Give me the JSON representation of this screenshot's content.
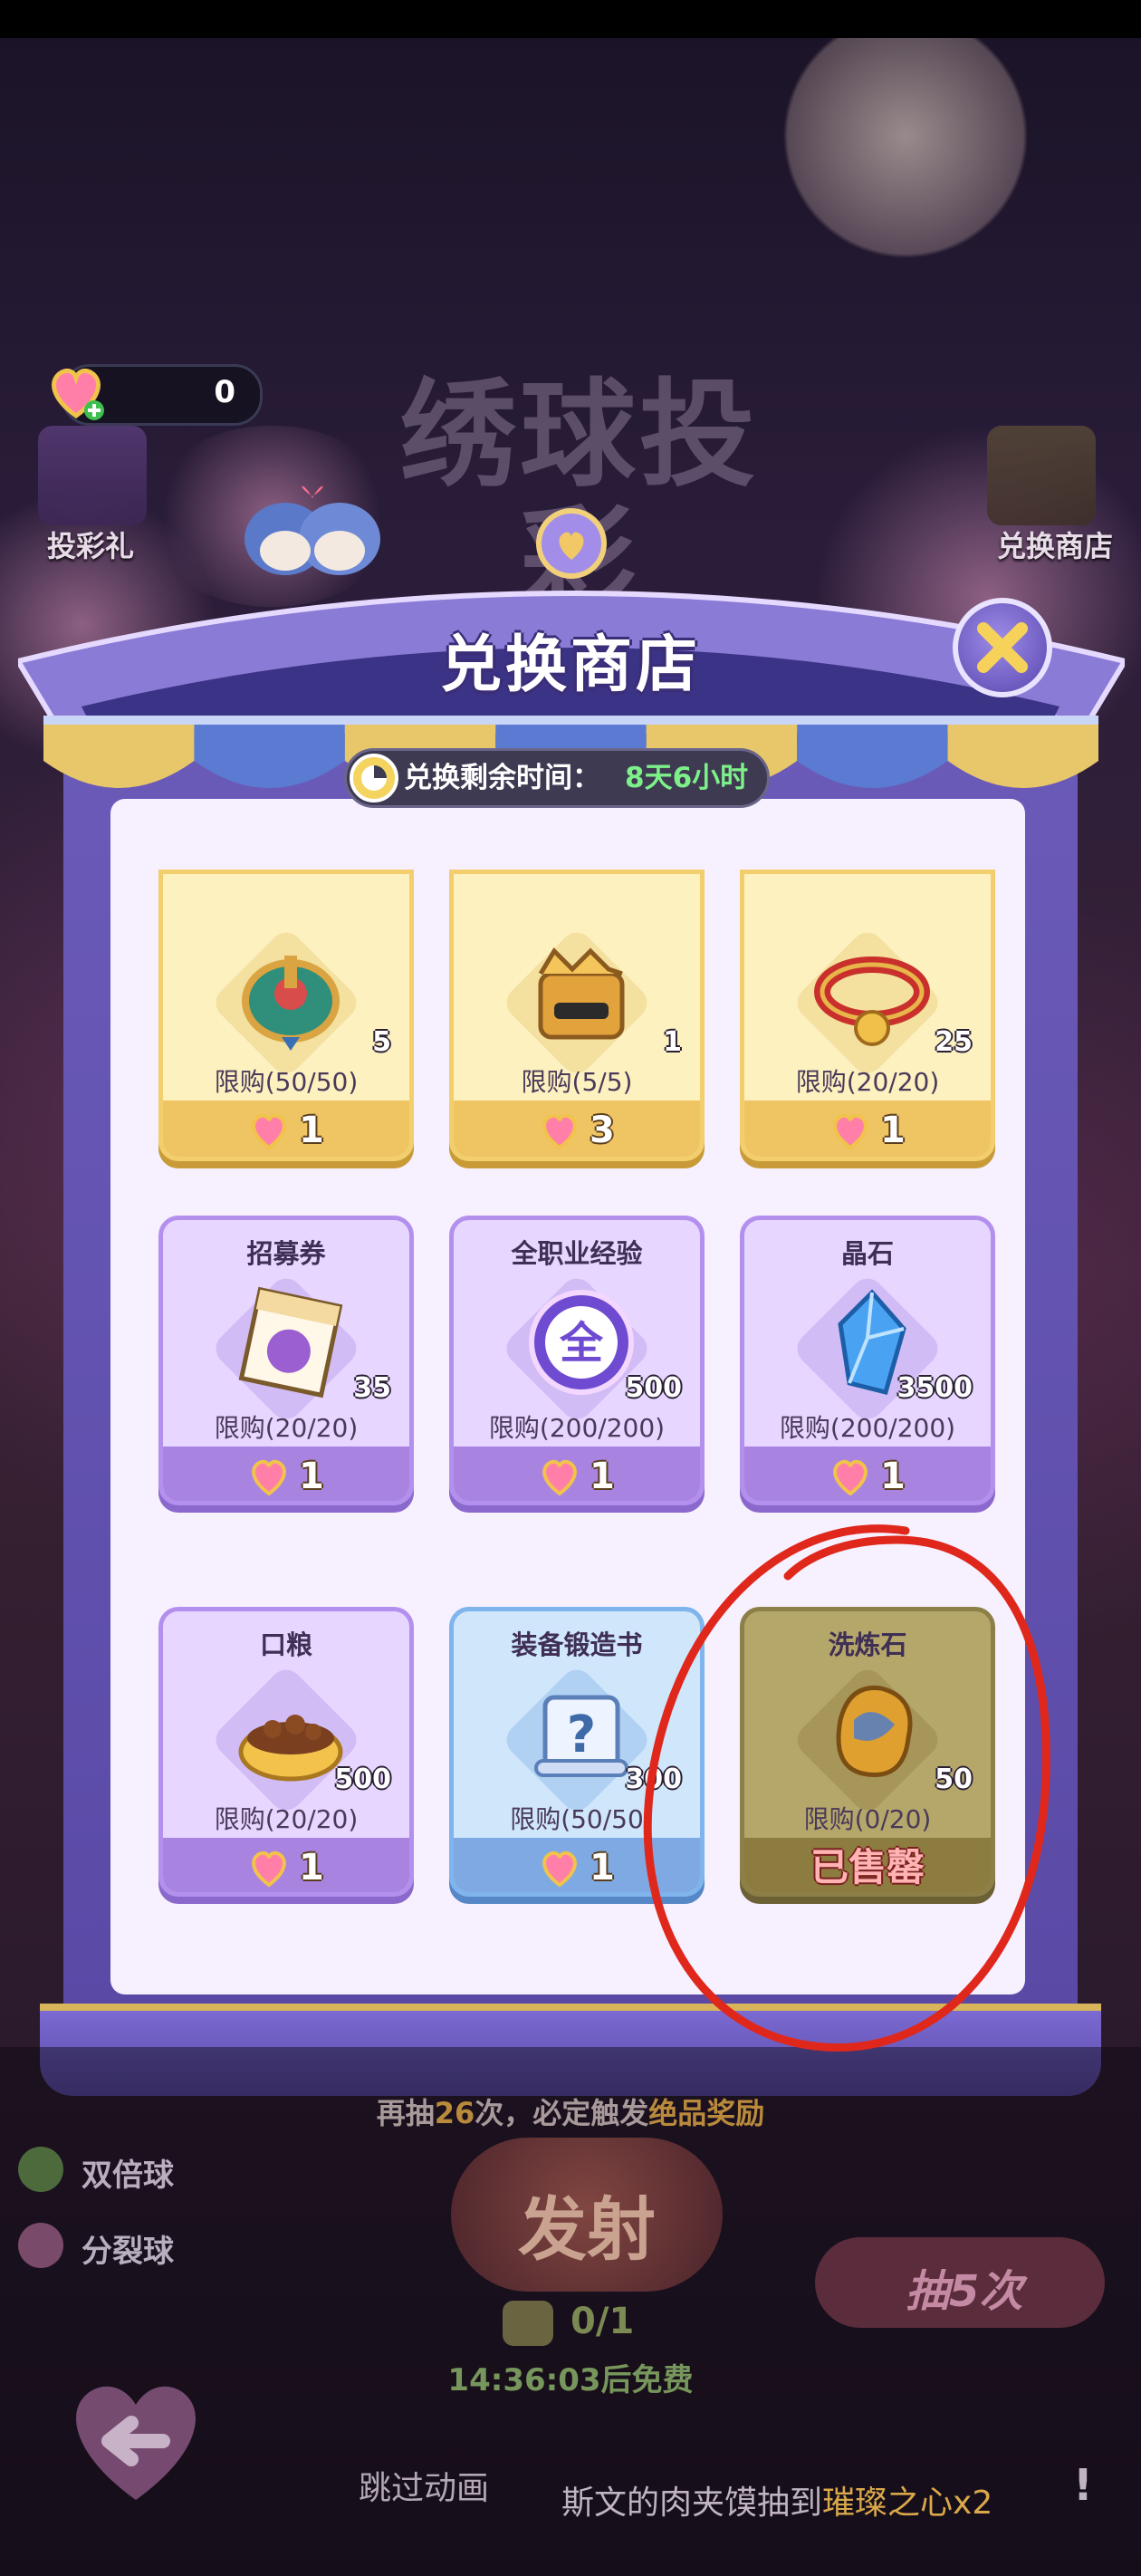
{
  "hud": {
    "currency_value": "0",
    "gift_label": "投彩礼",
    "shop_label": "兑换商店",
    "game_title": "绣球投彩"
  },
  "shop": {
    "title": "兑换商店",
    "timer_label": "兑换剩余时间：",
    "timer_value": "8天6小时",
    "items": [
      {
        "name": "",
        "icon": "spinning-top-icon",
        "qty": "5",
        "limit": "限购(50/50)",
        "price": "1",
        "style": "yellow"
      },
      {
        "name": "",
        "icon": "treasure-chest-icon",
        "qty": "1",
        "limit": "限购(5/5)",
        "price": "3",
        "style": "yellow"
      },
      {
        "name": "",
        "icon": "collar-icon",
        "qty": "25",
        "limit": "限购(20/20)",
        "price": "1",
        "style": "yellow"
      },
      {
        "name": "招募券",
        "icon": "ticket-icon",
        "qty": "35",
        "limit": "限购(20/20)",
        "price": "1",
        "style": "purple"
      },
      {
        "name": "全职业经验",
        "icon": "exp-orb-icon",
        "qty": "500",
        "limit": "限购(200/200)",
        "price": "1",
        "style": "purple"
      },
      {
        "name": "晶石",
        "icon": "crystal-icon",
        "qty": "3500",
        "limit": "限购(200/200)",
        "price": "1",
        "style": "purple"
      },
      {
        "name": "口粮",
        "icon": "food-bowl-icon",
        "qty": "500",
        "limit": "限购(20/20)",
        "price": "1",
        "style": "purple"
      },
      {
        "name": "装备锻造书",
        "icon": "scroll-icon",
        "qty": "300",
        "limit": "限购(50/50",
        "price": "1",
        "style": "blue"
      },
      {
        "name": "洗炼石",
        "icon": "refine-stone-icon",
        "qty": "50",
        "limit": "限购(0/20)",
        "price": "",
        "status": "已售罄",
        "style": "soldout"
      }
    ]
  },
  "bottom": {
    "double_ball": "双倍球",
    "split_ball": "分裂球",
    "hint_prefix": "再抽",
    "hint_count": "26",
    "hint_mid": "次，必定触发",
    "hint_reward": "绝品奖励",
    "fire_label": "发射",
    "draw5_label": "抽5次",
    "ticket_count": "0/1",
    "free_timer": "14:36:03后免费",
    "skip_animation": "跳过动画",
    "ticker_line2_prefix": "斯文的肉夹馍抽到",
    "ticker_line2_item": "璀璨之心x2",
    "exclamation": "!"
  },
  "colors": {
    "accent_green": "#7ef08a",
    "annotation_red": "#e0271c",
    "frame_purple": "#6b5ab8"
  }
}
